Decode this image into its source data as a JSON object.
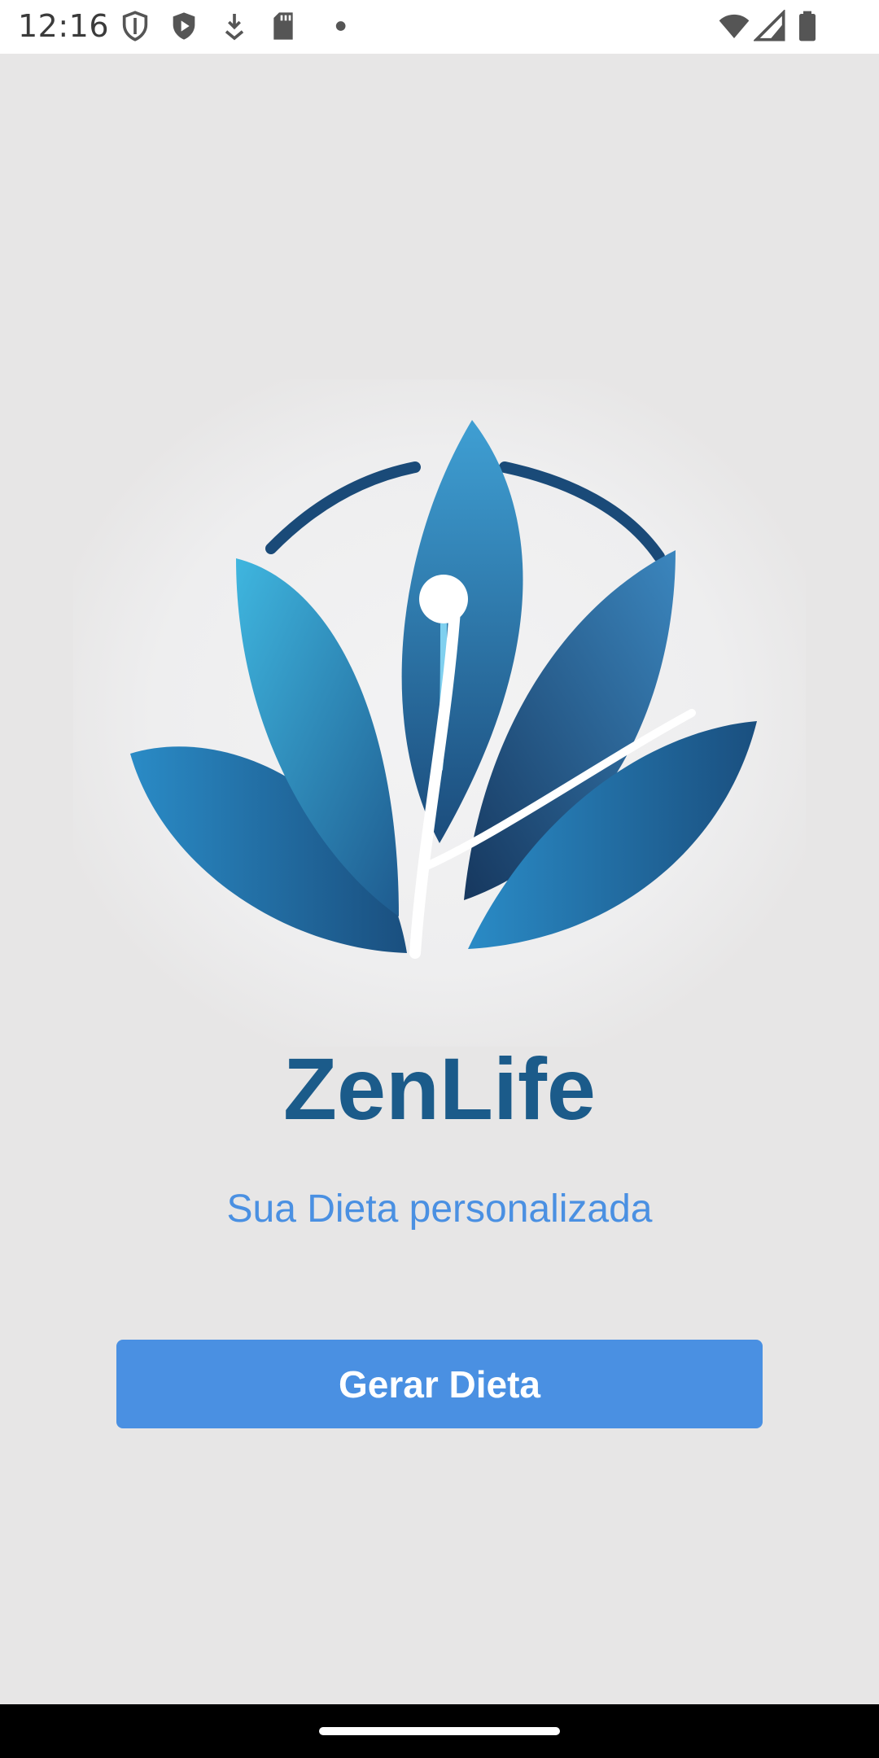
{
  "status_bar": {
    "time": "12:16",
    "left_icons": [
      "shield-outline-icon",
      "play-shield-icon",
      "download-icon",
      "sd-card-icon",
      "dot-icon"
    ],
    "right_icons": [
      "wifi-icon",
      "signal-icon",
      "battery-icon"
    ]
  },
  "app": {
    "title": "ZenLife",
    "subtitle": "Sua Dieta personalizada",
    "primary_button_label": "Gerar Dieta"
  },
  "colors": {
    "background": "#e7e6e6",
    "title": "#1b5b8a",
    "subtitle": "#4a90e2",
    "button": "#4a90e2",
    "button_text": "#ffffff"
  }
}
